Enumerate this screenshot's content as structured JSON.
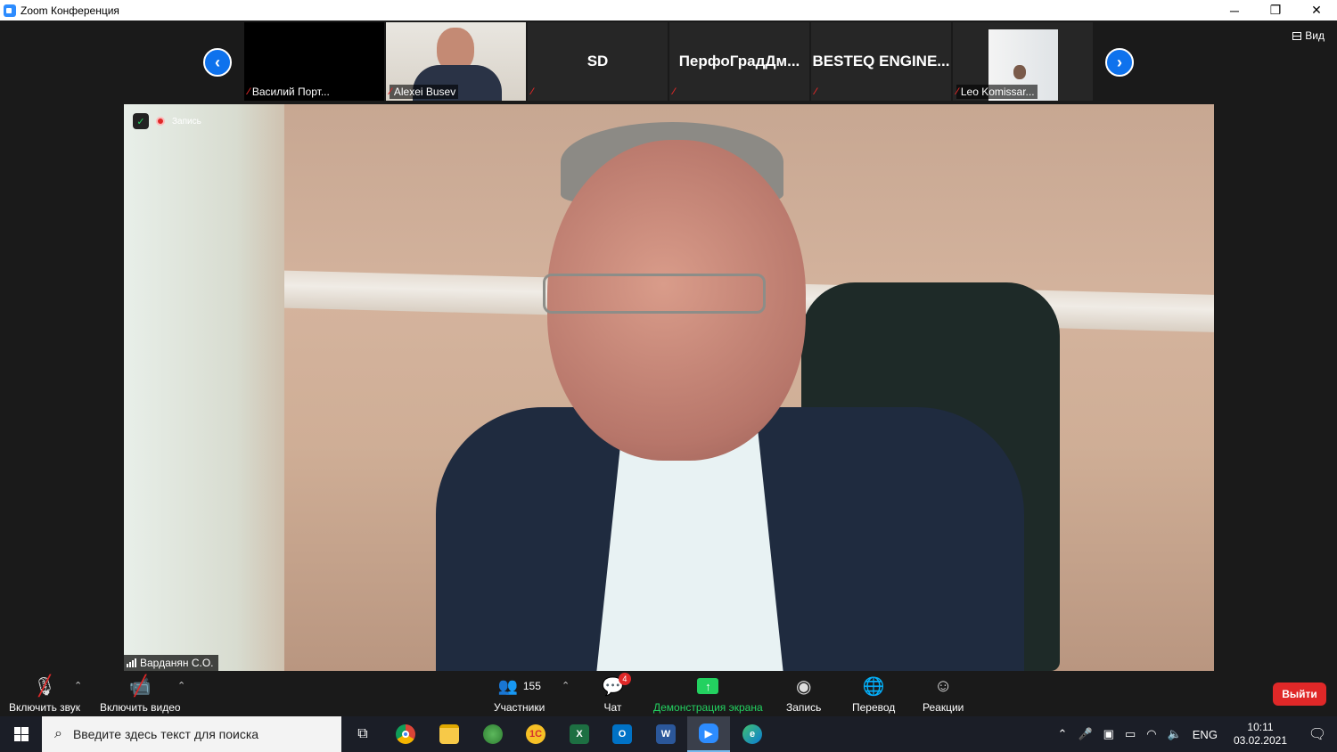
{
  "window": {
    "title": "Zoom Конференция",
    "controls": {
      "minimize": "─",
      "restore": "❐",
      "close": "✕"
    }
  },
  "meeting": {
    "view_label": "Вид",
    "nav": {
      "prev": "‹",
      "next": "›"
    },
    "participants_strip": [
      {
        "name": "Василий Порт...",
        "muted": true,
        "video": "dark"
      },
      {
        "name": "Alexei Busev",
        "muted": true,
        "video": "camera"
      },
      {
        "name": "",
        "center_name": "SD",
        "muted": true,
        "video": "off"
      },
      {
        "name": "",
        "center_name": "ПерфоГрадДм...",
        "muted": true,
        "video": "off"
      },
      {
        "name": "",
        "center_name": "BESTEQ  ENGINE...",
        "muted": true,
        "video": "off"
      },
      {
        "name": "Leo Komissar...",
        "muted": true,
        "video": "camera"
      }
    ],
    "recording_label": "Запись",
    "active_speaker": "Варданян С.О."
  },
  "toolbar": {
    "audio_label": "Включить звук",
    "video_label": "Включить видео",
    "participants_count": "155",
    "participants_label": "Участники",
    "chat_label": "Чат",
    "chat_badge": "4",
    "share_label": "Демонстрация экрана",
    "record_label": "Запись",
    "translate_label": "Перевод",
    "reactions_label": "Реакции",
    "leave_label": "Выйти"
  },
  "taskbar": {
    "search_placeholder": "Введите здесь текст для поиска",
    "lang": "ENG",
    "time": "10:11",
    "date": "03.02.2021",
    "apps": [
      "task-view",
      "chrome",
      "file-explorer",
      "maps",
      "1c",
      "excel",
      "outlook",
      "word",
      "zoom",
      "edge"
    ]
  },
  "colors": {
    "zoom_blue": "#0e72ed",
    "share_green": "#23d160",
    "leave_red": "#e02828"
  }
}
